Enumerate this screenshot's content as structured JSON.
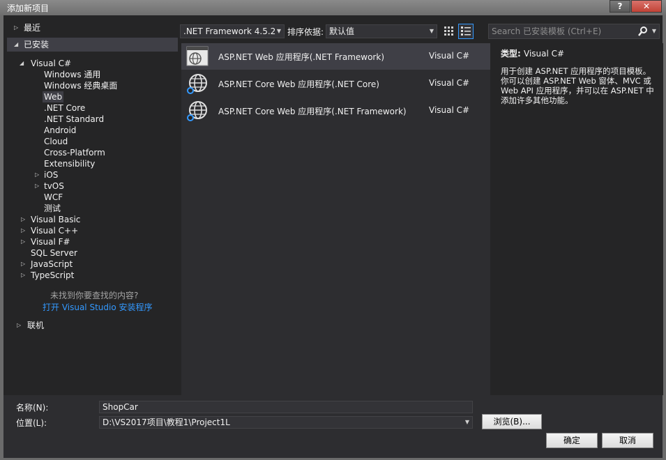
{
  "window": {
    "title": "添加新项目",
    "help_label": "?",
    "close_label": "✕"
  },
  "tree": {
    "recent": "最近",
    "installed": "已安装",
    "visual_csharp": "Visual C#",
    "csharp_children": [
      "Windows 通用",
      "Windows 经典桌面",
      "Web",
      ".NET Core",
      ".NET Standard",
      "Android",
      "Cloud",
      "Cross-Platform",
      "Extensibility",
      "iOS",
      "tvOS",
      "WCF",
      "测试"
    ],
    "other_langs": [
      "Visual Basic",
      "Visual C++",
      "Visual F#",
      "SQL Server",
      "JavaScript",
      "TypeScript"
    ],
    "not_found": "未找到你要查找的内容?",
    "open_installer": "打开 Visual Studio 安装程序",
    "online": "联机"
  },
  "toolbar": {
    "framework": ".NET Framework 4.5.2",
    "sort_label": "排序依据:",
    "sort_value": "默认值",
    "search_placeholder": "Search 已安装模板 (Ctrl+E)"
  },
  "templates": [
    {
      "name": "ASP.NET Web 应用程序(.NET Framework)",
      "lang": "Visual C#",
      "icon": "web-app-icon"
    },
    {
      "name": "ASP.NET Core Web 应用程序(.NET Core)",
      "lang": "Visual C#",
      "icon": "globe-icon"
    },
    {
      "name": "ASP.NET Core Web 应用程序(.NET Framework)",
      "lang": "Visual C#",
      "icon": "globe-icon"
    }
  ],
  "description": {
    "type_label": "类型:",
    "type_value": "Visual C#",
    "text": "用于创建 ASP.NET 应用程序的项目模板。你可以创建 ASP.NET Web 窗体、MVC 或 Web API 应用程序，并可以在 ASP.NET 中添加许多其他功能。"
  },
  "bottom": {
    "name_label": "名称(N):",
    "name_value": "ShopCar",
    "location_label": "位置(L):",
    "location_value": "D:\\VS2017项目\\教程1\\Project1L",
    "browse_label": "浏览(B)...",
    "ok_label": "确定",
    "cancel_label": "取消"
  },
  "colors": {
    "accent": "#3399ff",
    "background": "#252526"
  }
}
